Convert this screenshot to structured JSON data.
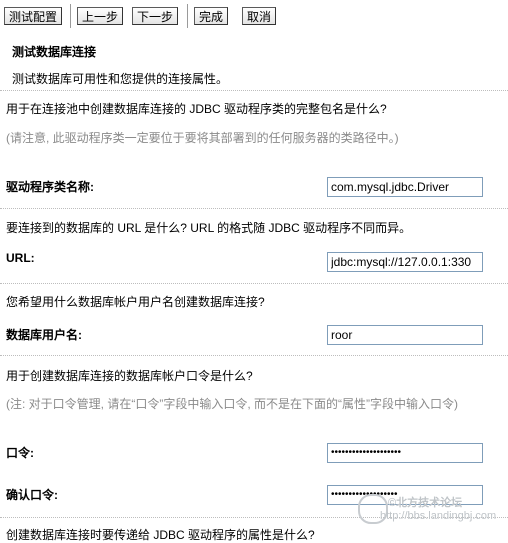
{
  "toolbar": {
    "test_config": "测试配置",
    "prev": "上一步",
    "next": "下一步",
    "finish": "完成",
    "cancel": "取消"
  },
  "section": {
    "title": "测试数据库连接",
    "subtitle": "测试数据库可用性和您提供的连接属性。"
  },
  "driver": {
    "question": "用于在连接池中创建数据库连接的 JDBC 驱动程序类的完整包名是什么?",
    "note": "(请注意, 此驱动程序类一定要位于要将其部署到的任何服务器的类路径中。)",
    "label": "驱动程序类名称:",
    "value": "com.mysql.jdbc.Driver"
  },
  "url": {
    "question": "要连接到的数据库的 URL 是什么? URL 的格式随 JDBC 驱动程序不同而异。",
    "label": "URL:",
    "value": "jdbc:mysql://127.0.0.1:330"
  },
  "user": {
    "question": "您希望用什么数据库帐户用户名创建数据库连接?",
    "label": "数据库用户名:",
    "value": "roor"
  },
  "password": {
    "question": "用于创建数据库连接的数据库帐户口令是什么?",
    "note": "(注: 对于口令管理, 请在“口令”字段中输入口令, 而不是在下面的“属性”字段中输入口令)",
    "label": "口令:",
    "value": "••••••••••••••••••••",
    "confirm_label": "确认口令:",
    "confirm_value": "•••••••••••••••••••"
  },
  "properties": {
    "question": "创建数据库连接时要传递给 JDBC 驱动程序的属性是什么?"
  },
  "watermark": {
    "line1": "©北方技术论坛",
    "line2": "http://bbs.landingbj.com"
  }
}
